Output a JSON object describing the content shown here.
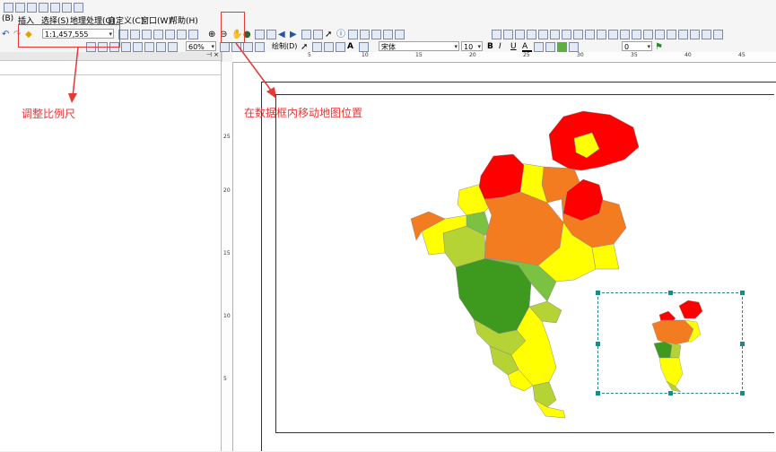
{
  "menu": {
    "items": [
      "(B)",
      "插入",
      "选择(S)",
      "地理处理(G)",
      "自定义(C)",
      "窗口(W)",
      "帮助(H)"
    ]
  },
  "toolbar": {
    "scale_value": "1:1,457,555",
    "zoom_value": "60%",
    "draw_label": "绘制(D)",
    "font_name": "宋体",
    "font_size": "10",
    "bold_label": "B",
    "italic_label": "I",
    "underline_label": "U",
    "font_color_label": "A",
    "rotation_value": "0"
  },
  "annotations": {
    "scale_callout": "调整比例尺",
    "pan_callout": "在数据框内移动地图位置"
  },
  "ruler": {
    "h_ticks": [
      "5",
      "10",
      "15",
      "20",
      "25",
      "30",
      "35",
      "40",
      "45"
    ],
    "v_ticks": [
      "25",
      "20",
      "15",
      "10",
      "5"
    ]
  },
  "colors": {
    "red": "#ff0000",
    "orange": "#f47c20",
    "yellow": "#ffff00",
    "yellow_green": "#b5d334",
    "light_green": "#7cc242",
    "green": "#3d9a1e",
    "annotation_red": "#e53935",
    "selection_teal": "#1d8a8a"
  }
}
